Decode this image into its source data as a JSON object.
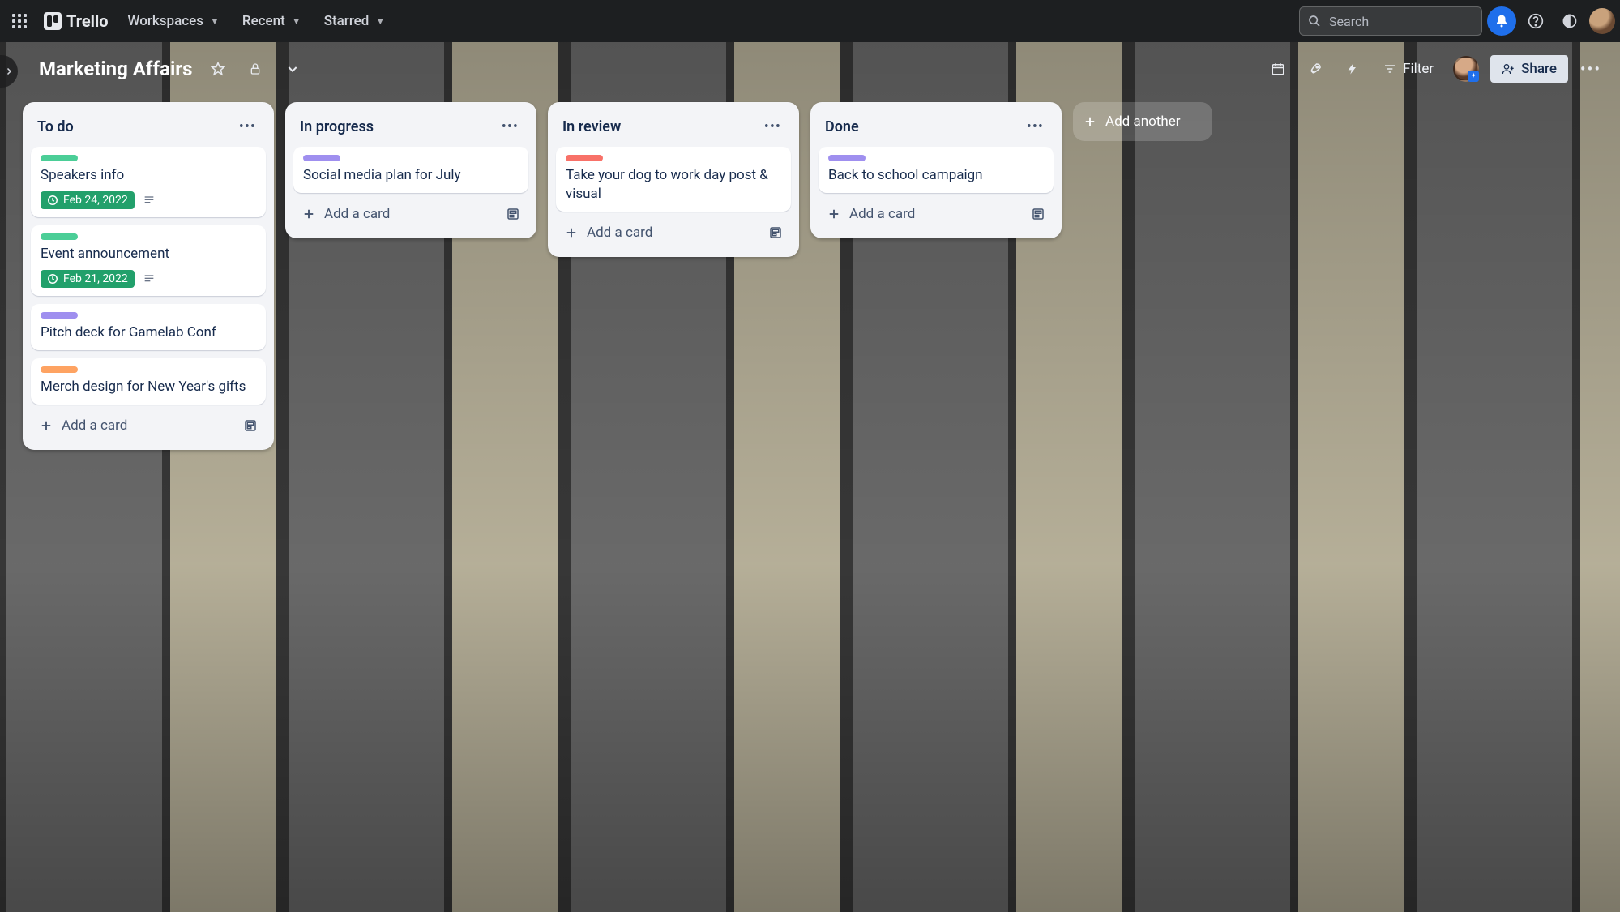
{
  "app": {
    "name": "Trello"
  },
  "topnav": {
    "workspaces": "Workspaces",
    "recent": "Recent",
    "starred": "Starred",
    "search_placeholder": "Search"
  },
  "board": {
    "title": "Marketing Affairs",
    "filter": "Filter",
    "share": "Share",
    "add_another_list": "Add another"
  },
  "add_card_label": "Add a card",
  "lists": [
    {
      "title": "To do",
      "cards": [
        {
          "label_color": "green",
          "title": "Speakers info",
          "date": "Feb 24, 2022",
          "has_desc": true
        },
        {
          "label_color": "green",
          "title": "Event announcement",
          "date": "Feb 21, 2022",
          "has_desc": true
        },
        {
          "label_color": "purple",
          "title": "Pitch deck for Gamelab Conf"
        },
        {
          "label_color": "orange",
          "title": "Merch design for New Year's gifts"
        }
      ]
    },
    {
      "title": "In progress",
      "cards": [
        {
          "label_color": "purple",
          "title": "Social media plan for July"
        }
      ]
    },
    {
      "title": "In review",
      "cards": [
        {
          "label_color": "red",
          "title": "Take your dog to work day post & visual"
        }
      ]
    },
    {
      "title": "Done",
      "cards": [
        {
          "label_color": "purple",
          "title": "Back to school campaign"
        }
      ]
    }
  ]
}
